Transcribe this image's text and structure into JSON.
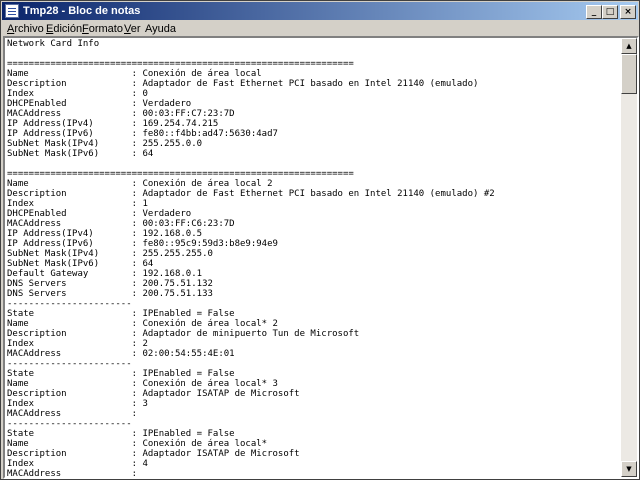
{
  "window": {
    "title": "Tmp28 - Bloc de notas"
  },
  "titlebar_buttons": {
    "minimize": "_",
    "maximize": "□",
    "close": "×"
  },
  "menu": {
    "items": [
      {
        "mnemonic": "A",
        "rest": "rchivo"
      },
      {
        "mnemonic": "E",
        "rest": "dición"
      },
      {
        "mnemonic": "F",
        "rest": "ormato"
      },
      {
        "mnemonic": "V",
        "rest": "er"
      },
      {
        "mnemonic": "",
        "rest": "Ayuda"
      }
    ]
  },
  "scrollbar": {
    "up_arrow": "▲",
    "down_arrow": "▼"
  },
  "document": {
    "lines": [
      "Network Card Info",
      "",
      "================================================================",
      "Name                   : Conexión de área local",
      "Description            : Adaptador de Fast Ethernet PCI basado en Intel 21140 (emulado)",
      "Index                  : 0",
      "DHCPEnabled            : Verdadero",
      "MACAddress             : 00:03:FF:C7:23:7D",
      "IP Address(IPv4)       : 169.254.74.215",
      "IP Address(IPv6)       : fe80::f4bb:ad47:5630:4ad7",
      "SubNet Mask(IPv4)      : 255.255.0.0",
      "SubNet Mask(IPv6)      : 64",
      "",
      "================================================================",
      "Name                   : Conexión de área local 2",
      "Description            : Adaptador de Fast Ethernet PCI basado en Intel 21140 (emulado) #2",
      "Index                  : 1",
      "DHCPEnabled            : Verdadero",
      "MACAddress             : 00:03:FF:C6:23:7D",
      "IP Address(IPv4)       : 192.168.0.5",
      "IP Address(IPv6)       : fe80::95c9:59d3:b8e9:94e9",
      "SubNet Mask(IPv4)      : 255.255.255.0",
      "SubNet Mask(IPv6)      : 64",
      "Default Gateway        : 192.168.0.1",
      "DNS Servers            : 200.75.51.132",
      "DNS Servers            : 200.75.51.133",
      "-----------------------",
      "State                  : IPEnabled = False",
      "Name                   : Conexión de área local* 2",
      "Description            : Adaptador de minipuerto Tun de Microsoft",
      "Index                  : 2",
      "MACAddress             : 02:00:54:55:4E:01",
      "-----------------------",
      "State                  : IPEnabled = False",
      "Name                   : Conexión de área local* 3",
      "Description            : Adaptador ISATAP de Microsoft",
      "Index                  : 3",
      "MACAddress             :",
      "-----------------------",
      "State                  : IPEnabled = False",
      "Name                   : Conexión de área local*",
      "Description            : Adaptador ISATAP de Microsoft",
      "Index                  : 4",
      "MACAddress             :"
    ]
  }
}
